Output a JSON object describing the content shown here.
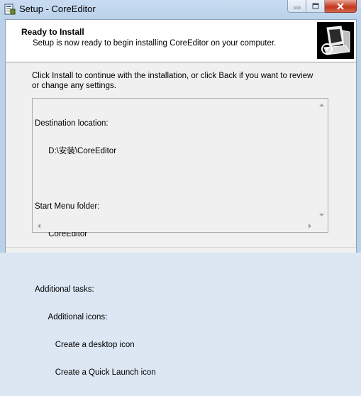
{
  "window": {
    "title": "Setup - CoreEditor",
    "icons": {
      "app": "setup-app-icon",
      "minimize": "minimize-icon",
      "maximize": "maximize-icon",
      "close": "close-icon"
    }
  },
  "header": {
    "title": "Ready to Install",
    "subtitle": "Setup is now ready to begin installing CoreEditor on your computer.",
    "image": "wizard-computer-icon"
  },
  "intro": "Click Install to continue with the installation, or click Back if you want to review or change any settings.",
  "memo": {
    "lines": [
      "Destination location:",
      "      D:\\安装\\CoreEditor",
      "",
      "Start Menu folder:",
      "      CoreEditor",
      "",
      "Additional tasks:",
      "      Additional icons:",
      "         Create a desktop icon",
      "         Create a Quick Launch icon"
    ]
  },
  "colors": {
    "title_bar": "#b9d1ea",
    "close_button": "#c43a22",
    "client_bg": "#f0f0f0"
  }
}
